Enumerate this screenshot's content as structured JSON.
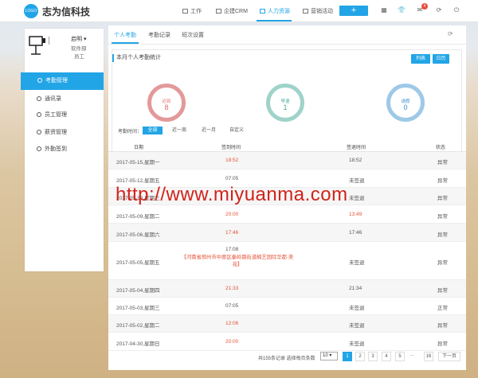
{
  "header": {
    "logo_text": "LOGO",
    "brand": "志为信科技",
    "nav": [
      "工作",
      "企建CRM",
      "人力资源",
      "营销活动"
    ],
    "add_label": "+",
    "mail_badge": "4"
  },
  "sidebar": {
    "user_name": "启明 ▾",
    "user_dept": "软件部",
    "user_role": "员工",
    "items": [
      "考勤管理",
      "通讯录",
      "员工管理",
      "薪资管理",
      "外勤签到"
    ]
  },
  "tabs": [
    "个人考勤",
    "考勤记录",
    "班次设置"
  ],
  "stats": {
    "title": "本月个人考勤统计",
    "btn_list": "列表",
    "btn_calendar": "日历",
    "late_label": "迟到",
    "late_value": "8",
    "early_label": "早退",
    "early_value": "1",
    "leave_label": "请假",
    "leave_value": "0",
    "colors": {
      "late": "#e08a8a",
      "early": "#8fcfc4",
      "leave": "#8ec1e6"
    }
  },
  "filter": {
    "label": "考勤时间：",
    "options": [
      "全部",
      "近一周",
      "近一月",
      "自定义"
    ],
    "selected": "全部"
  },
  "table": {
    "headers": [
      "日期",
      "签到时间",
      "签退时间",
      "状态"
    ],
    "rows": [
      {
        "date": "2017-05-15,星期一",
        "in": "18:52",
        "out": "18:52",
        "status": "异常"
      },
      {
        "date": "2017-05-12,星期五",
        "in": "07:05",
        "out": "未签退",
        "status": "异常"
      },
      {
        "date": "2017-05-10,星期三",
        "in": "",
        "out": "未签退",
        "status": "异常"
      },
      {
        "date": "2017-05-09,星期二",
        "in": "20:00",
        "out": "13:49",
        "status": "异常"
      },
      {
        "date": "2017-05-06,星期六",
        "in": "17:46",
        "out": "17:46",
        "status": "异常"
      },
      {
        "date": "2017-05-05,星期五",
        "in": "17:08",
        "out": "未签退",
        "status": "异常",
        "location": "【河南省郑州市中原区秦岭路街道楠艺国际华都·美苑】"
      },
      {
        "date": "2017-05-04,星期四",
        "in": "21:33",
        "out": "21:34",
        "status": "异常"
      },
      {
        "date": "2017-05-03,星期三",
        "in": "07:05",
        "out": "未签退",
        "status": "正常"
      },
      {
        "date": "2017-05-02,星期二",
        "in": "12:06",
        "out": "未签退",
        "status": "异常"
      },
      {
        "date": "2017-04-30,星期日",
        "in": "20:00",
        "out": "未签退",
        "status": "异常"
      }
    ]
  },
  "pagination": {
    "info": "共155条记录 选择每页条数",
    "per_page": "10",
    "pages": [
      "1",
      "2",
      "3",
      "4",
      "5"
    ],
    "ellipsis": "...",
    "last": "16",
    "next": "下一页"
  },
  "watermark": "http://www.miyuanma.com"
}
